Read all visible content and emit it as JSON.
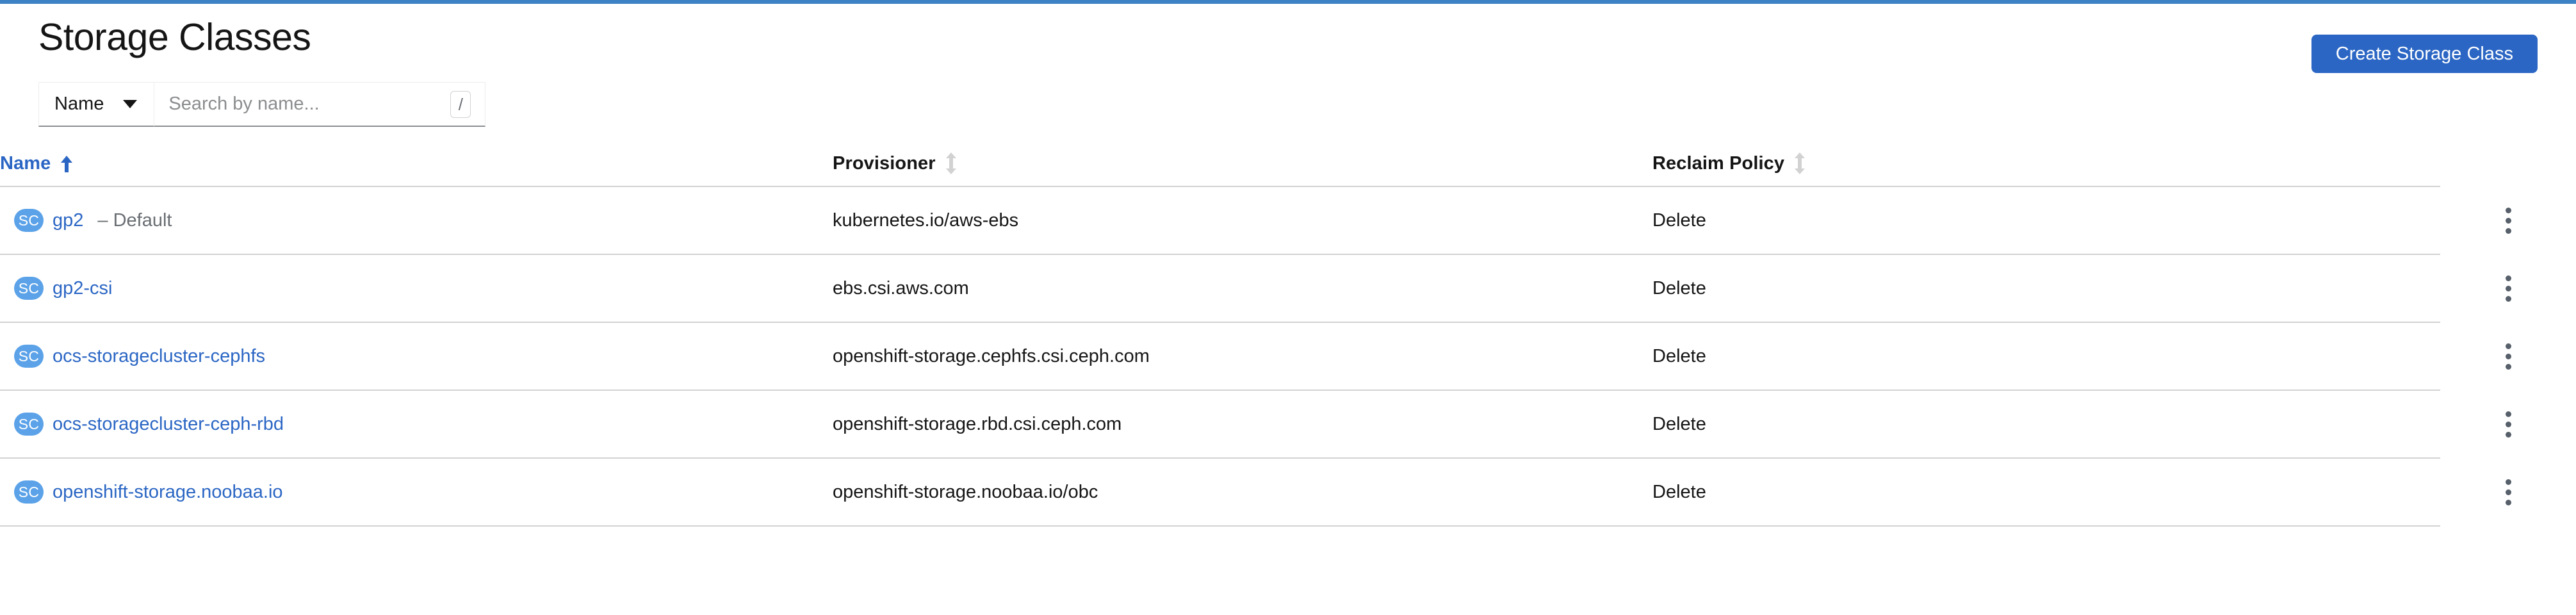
{
  "page": {
    "title": "Storage Classes",
    "accent_color": "#3c82c4"
  },
  "actions": {
    "create_button_label": "Create Storage Class",
    "create_button_color": "#2b66c4"
  },
  "toolbar": {
    "filter_select_label": "Name",
    "filter_select_icon": "chevron-down-icon",
    "search_placeholder": "Search by name...",
    "search_value": "",
    "search_shortcut": "/"
  },
  "table": {
    "columns": [
      {
        "label": "Name",
        "sort": "asc",
        "sort_icon": "sort-asc-icon"
      },
      {
        "label": "Provisioner",
        "sort": "none",
        "sort_icon": "sort-both-icon"
      },
      {
        "label": "Reclaim Policy",
        "sort": "none",
        "sort_icon": "sort-both-icon"
      }
    ],
    "row_kebab_icon": "kebab-menu-icon",
    "badge_text": "SC",
    "badge_color": "#5ba2e8",
    "link_color": "#2b66c4",
    "rows": [
      {
        "badge": "SC",
        "name": "gp2",
        "suffix": "– Default",
        "provisioner": "kubernetes.io/aws-ebs",
        "reclaim_policy": "Delete"
      },
      {
        "badge": "SC",
        "name": "gp2-csi",
        "suffix": "",
        "provisioner": "ebs.csi.aws.com",
        "reclaim_policy": "Delete"
      },
      {
        "badge": "SC",
        "name": "ocs-storagecluster-cephfs",
        "suffix": "",
        "provisioner": "openshift-storage.cephfs.csi.ceph.com",
        "reclaim_policy": "Delete"
      },
      {
        "badge": "SC",
        "name": "ocs-storagecluster-ceph-rbd",
        "suffix": "",
        "provisioner": "openshift-storage.rbd.csi.ceph.com",
        "reclaim_policy": "Delete"
      },
      {
        "badge": "SC",
        "name": "openshift-storage.noobaa.io",
        "suffix": "",
        "provisioner": "openshift-storage.noobaa.io/obc",
        "reclaim_policy": "Delete"
      }
    ]
  }
}
